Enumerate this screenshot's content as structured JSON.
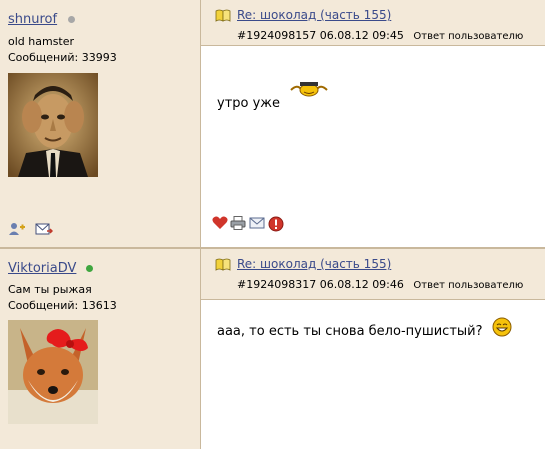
{
  "posts": [
    {
      "author": "shnurof",
      "online": false,
      "user_title": "old hamster",
      "messages_label": "Сообщений: 33993",
      "title": "Re: шоколад (часть 155)",
      "post_id": "#1924098157",
      "date": "06.08.12",
      "time": "09:45",
      "reply_label": "Ответ пользователю",
      "body": "утро уже"
    },
    {
      "author": "ViktoriaDV",
      "online": true,
      "user_title": "Сам ты рыжая",
      "messages_label": "Сообщений: 13613",
      "title": "Re: шоколад (часть 155)",
      "post_id": "#1924098317",
      "date": "06.08.12",
      "time": "09:46",
      "reply_label": "Ответ пользователю",
      "body": "ааа, то есть ты снова бело-пушистый?"
    }
  ],
  "colors": {
    "sidebar_bg": "#f3e9d9",
    "link": "#3a4a8a",
    "online": "#3fa63f",
    "offline": "#a7a7a7"
  },
  "icons": [
    "book-icon",
    "add-friend-icon",
    "send-message-icon",
    "heart-icon",
    "print-icon",
    "email-icon",
    "report-icon",
    "smiley-icon"
  ]
}
